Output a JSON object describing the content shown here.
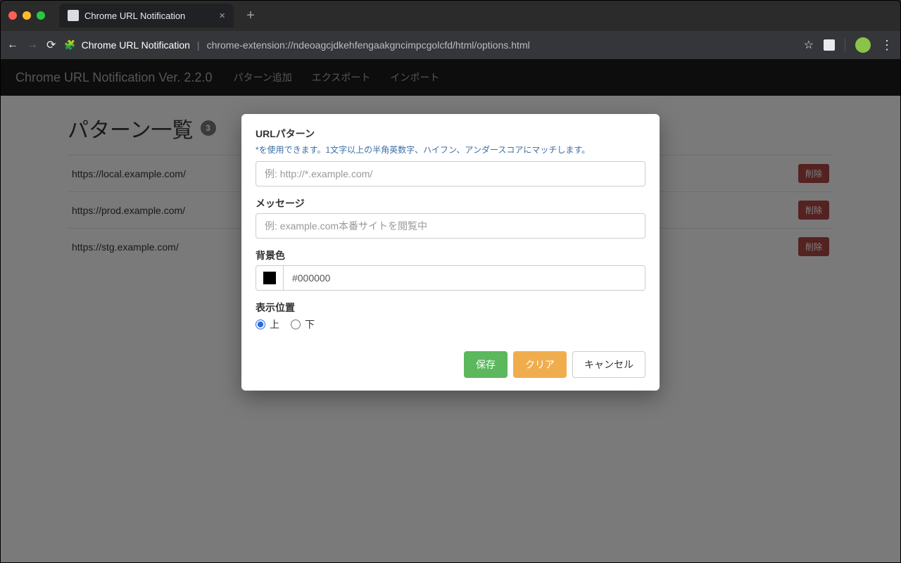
{
  "browser": {
    "tab_title": "Chrome URL Notification",
    "omnibar_title": "Chrome URL Notification",
    "omnibar_url": "chrome-extension://ndeoagcjdkehfengaakgncimpcgolcfd/html/options.html"
  },
  "navbar": {
    "brand": "Chrome URL Notification  Ver. 2.2.0",
    "links": [
      "パターン追加",
      "エクスポート",
      "インポート"
    ]
  },
  "page": {
    "heading": "パターン一覧",
    "count": "3",
    "rows": [
      {
        "url": "https://local.example.com/",
        "delete": "削除"
      },
      {
        "url": "https://prod.example.com/",
        "delete": "削除"
      },
      {
        "url": "https://stg.example.com/",
        "delete": "削除"
      }
    ]
  },
  "modal": {
    "url_label": "URLパターン",
    "url_help": "*を使用できます。1文字以上の半角英数字、ハイフン、アンダースコアにマッチします。",
    "url_placeholder": "例: http://*.example.com/",
    "message_label": "メッセージ",
    "message_placeholder": "例: example.com本番サイトを閲覧中",
    "bgcolor_label": "背景色",
    "bgcolor_value": "#000000",
    "position_label": "表示位置",
    "position_top": "上",
    "position_bottom": "下",
    "save": "保存",
    "clear": "クリア",
    "cancel": "キャンセル"
  }
}
